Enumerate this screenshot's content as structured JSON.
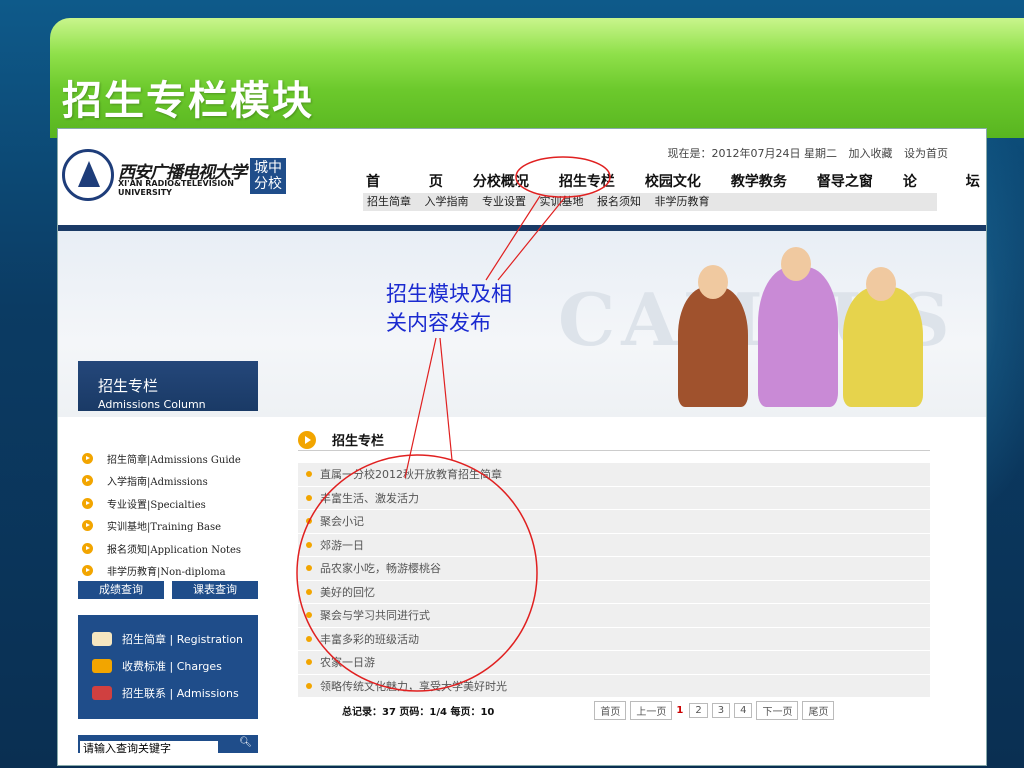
{
  "slide": {
    "title": "招生专栏模块"
  },
  "site": {
    "logo_cn": "西安广播电视大学",
    "logo_en": "XI'AN RADIO&TELEVISION UNIVERSITY",
    "logo_badge": "城中分校",
    "topline": {
      "date": "现在是：2012年07月24日 星期二",
      "fav": "加入收藏",
      "home": "设为首页"
    },
    "nav": [
      "首 页",
      "分校概况",
      "招生专栏",
      "校园文化",
      "教学教务",
      "督导之窗",
      "论 坛"
    ],
    "subnav": [
      "招生简章",
      "入学指南",
      "专业设置",
      "实训基地",
      "报名须知",
      "非学历教育"
    ],
    "banner_text": "CAMPUS"
  },
  "sidebar": {
    "title_cn": "招生专栏",
    "title_en": "Admissions Column",
    "items": [
      "招生简章|Admissions Guide",
      "入学指南|Admissions",
      "专业设置|Specialties",
      "实训基地|Training Base",
      "报名须知|Application Notes",
      "非学历教育|Non-diploma"
    ],
    "buttons": [
      "成绩查询",
      "课表查询"
    ],
    "links": [
      "招生简章 | Registration",
      "收费标准 | Charges",
      "招生联系 | Admissions"
    ],
    "search_placeholder": "请输入查询关键字",
    "search_icon": "search-icon"
  },
  "content": {
    "section_title": "招生专栏",
    "rows": [
      "直属一分校2012秋开放教育招生简章",
      "丰富生活、激发活力",
      "聚会小记",
      "郊游一日",
      "品农家小吃，畅游樱桃谷",
      "美好的回忆",
      "聚会与学习共同进行式",
      "丰富多彩的班级活动",
      "农家一日游",
      "领略传统文化魅力，享受大学美好时光"
    ],
    "pager": {
      "info": "总记录：37 页码：1/4 每页：10",
      "first": "首页",
      "prev": "上一页",
      "current": "1",
      "pages": [
        "2",
        "3",
        "4"
      ],
      "next": "下一页",
      "last": "尾页"
    }
  },
  "annotation": {
    "line1": "招生模块及相",
    "line2": "关内容发布"
  }
}
